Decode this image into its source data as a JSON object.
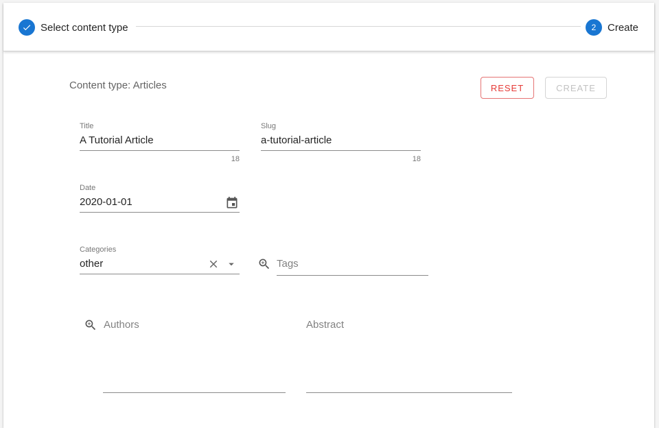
{
  "stepper": {
    "steps": [
      {
        "label": "Select content type",
        "state": "completed",
        "icon": "check-icon"
      },
      {
        "label": "Create",
        "state": "active",
        "number": "2"
      }
    ]
  },
  "header": {
    "content_type": "Content type: Articles",
    "reset_label": "RESET",
    "create_label": "CREATE"
  },
  "form": {
    "title": {
      "label": "Title",
      "value": "A Tutorial Article",
      "counter": "18"
    },
    "slug": {
      "label": "Slug",
      "value": "a-tutorial-article",
      "counter": "18"
    },
    "date": {
      "label": "Date",
      "value": "2020-01-01",
      "icon": "calendar-icon"
    },
    "categories": {
      "label": "Categories",
      "value": "other",
      "icons": [
        "clear-icon",
        "dropdown-arrow-icon"
      ]
    },
    "tags": {
      "placeholder": "Tags",
      "icon": "zoom-in-icon"
    },
    "authors": {
      "placeholder": "Authors",
      "icon": "zoom-in-icon"
    },
    "abstract": {
      "placeholder": "Abstract"
    }
  },
  "colors": {
    "primary": "#1976d2",
    "danger": "#e53935",
    "disabled": "#c2c2c2"
  }
}
